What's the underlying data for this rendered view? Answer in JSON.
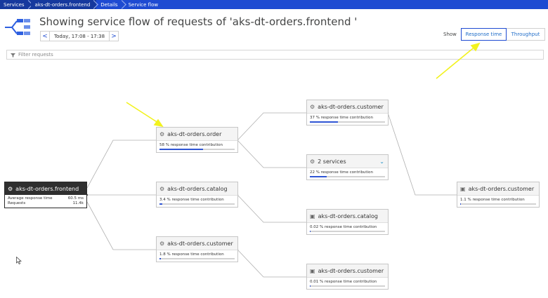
{
  "breadcrumb": [
    "Services",
    "aks-dt-orders.frontend",
    "Details",
    "Service flow"
  ],
  "title": "Showing service flow of requests of 'aks-dt-orders.frontend '",
  "timeframe": {
    "prev": "<",
    "label": "Today, 17:08 - 17:38",
    "next": ">"
  },
  "show": {
    "label": "Show",
    "options": [
      "Response time",
      "Throughput"
    ],
    "active": "Response time"
  },
  "filter": {
    "placeholder": "Filter requests"
  },
  "colors": {
    "brand": "#1e4bd2",
    "bar_fill": "#2f55d4",
    "highlight_arrow": "#f2f21e"
  },
  "nodes": {
    "frontend": {
      "name": "aks-dt-orders.frontend",
      "rows": [
        {
          "label": "Average response time",
          "value": "60.5 ms"
        },
        {
          "label": "Requests",
          "value": "11.4k"
        }
      ]
    },
    "order": {
      "name": "aks-dt-orders.order",
      "pct": "58 % response time contribution",
      "fraction": 0.58
    },
    "catalog1": {
      "name": "aks-dt-orders.catalog",
      "pct": "3.4 % response time contribution",
      "fraction": 0.034
    },
    "customer1": {
      "name": "aks-dt-orders.customer",
      "pct": "1.8 % response time contribution",
      "fraction": 0.018
    },
    "customer2": {
      "name": "aks-dt-orders.customer",
      "pct": "37 % response time contribution",
      "fraction": 0.37
    },
    "services": {
      "name": "2 services",
      "pct": "22 % response time contribution",
      "fraction": 0.22
    },
    "catalog2": {
      "name": "aks-dt-orders.catalog",
      "pct": "0.02 % response time contribution",
      "fraction": 0.0002
    },
    "customer3": {
      "name": "aks-dt-orders.customer",
      "pct": "0.01 % response time contribution",
      "fraction": 0.0001
    },
    "customer4": {
      "name": "aks-dt-orders.customer",
      "pct": "1.1 % response time contribution",
      "fraction": 0.011
    }
  }
}
